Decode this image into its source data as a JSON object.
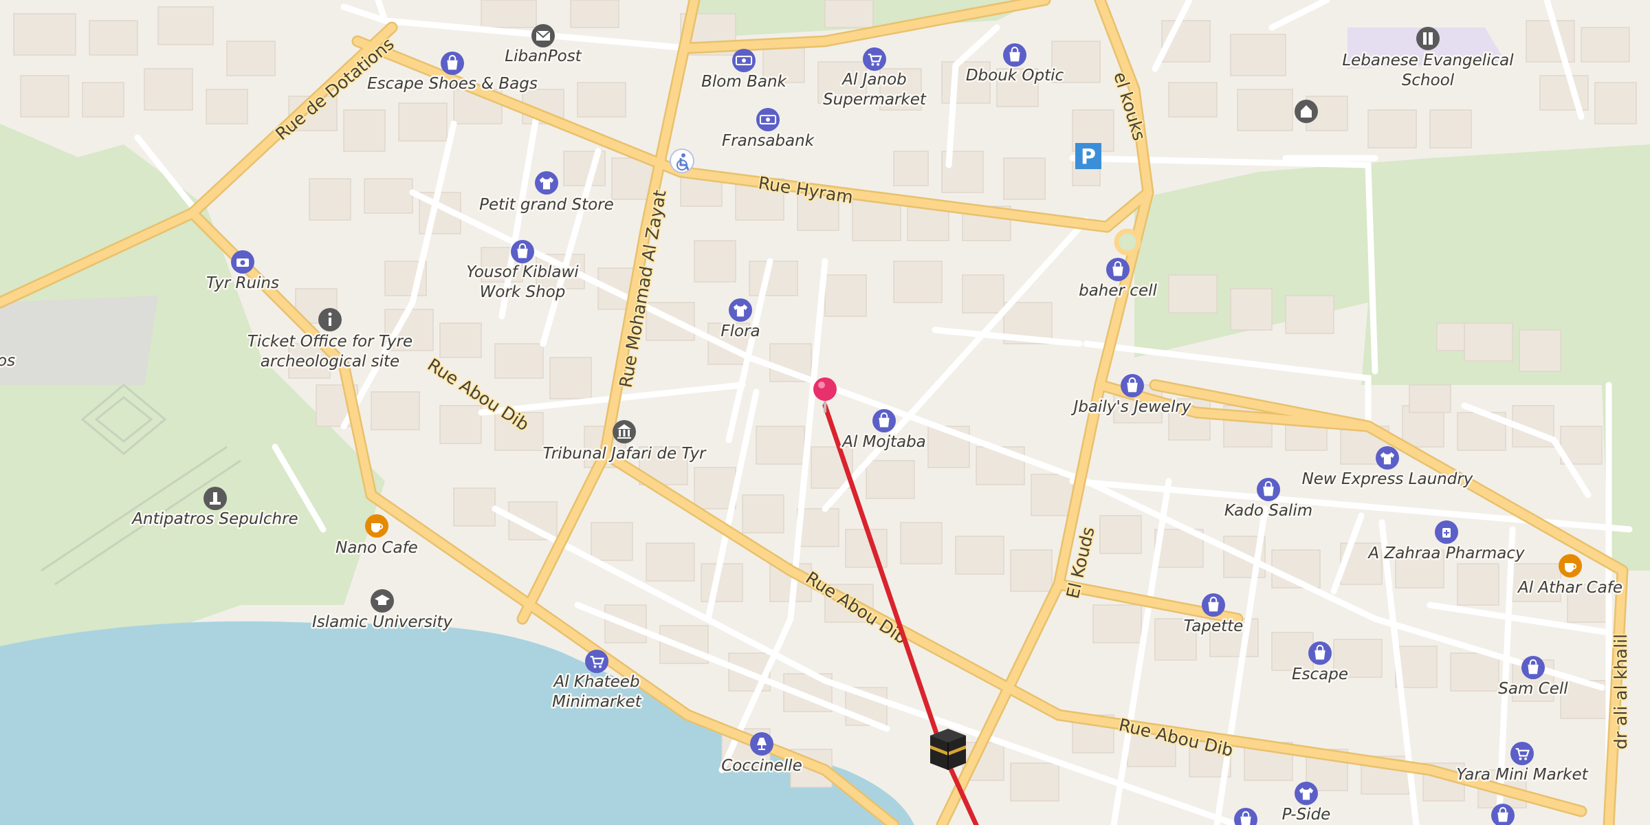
{
  "map": {
    "colors": {
      "land": "#f2efe9",
      "park": "#d8e8c8",
      "water": "#aad3df",
      "major_road": "#fcd68a",
      "minor_road": "#ffffff",
      "route": "#d9232d",
      "poi_icon": "#5b5fc7",
      "cafe_icon": "#e58a00",
      "pin": "#e8306b"
    },
    "pois": [
      {
        "id": "libanpost",
        "label": "LibanPost",
        "icon": "envelope-icon"
      },
      {
        "id": "escape-shoes",
        "label": "Escape Shoes & Bags",
        "icon": "shopping-bag-icon"
      },
      {
        "id": "blom-bank",
        "label": "Blom Bank",
        "icon": "banknote-icon"
      },
      {
        "id": "al-janob",
        "label": "Al Janob Supermarket",
        "icon": "shopping-cart-icon"
      },
      {
        "id": "dbouk-optic",
        "label": "Dbouk Optic",
        "icon": "shopping-bag-icon"
      },
      {
        "id": "fransabank",
        "label": "Fransabank",
        "icon": "banknote-icon"
      },
      {
        "id": "lebanese-evangelical",
        "label": "Lebanese Evangelical School",
        "icon": "school-icon"
      },
      {
        "id": "petit-grand-store",
        "label": "Petit grand Store",
        "icon": "shirt-icon"
      },
      {
        "id": "yousof-kiblawi",
        "label": "Yousof Kiblawi Work Shop",
        "icon": "shopping-bag-icon"
      },
      {
        "id": "flora",
        "label": "Flora",
        "icon": "shirt-icon"
      },
      {
        "id": "baher-cell",
        "label": "baher cell",
        "icon": "shopping-bag-icon"
      },
      {
        "id": "tyr-ruins",
        "label": "Tyr Ruins",
        "icon": "camera-icon"
      },
      {
        "id": "ticket-office",
        "label": "Ticket Office for Tyre archeological site",
        "icon": "info-icon"
      },
      {
        "id": "tribunal",
        "label": "Tribunal Jafari de Tyr",
        "icon": "courthouse-icon"
      },
      {
        "id": "al-mojtaba",
        "label": "Al Mojtaba",
        "icon": "shopping-bag-icon"
      },
      {
        "id": "jbailys-jewelry",
        "label": "Jbaily's Jewelry",
        "icon": "shopping-bag-icon"
      },
      {
        "id": "new-express-laundry",
        "label": "New Express Laundry",
        "icon": "shirt-icon"
      },
      {
        "id": "kado-salim",
        "label": "Kado Salim",
        "icon": "shopping-bag-icon"
      },
      {
        "id": "a-zahraa-pharmacy",
        "label": "A Zahraa Pharmacy",
        "icon": "pharmacy-icon"
      },
      {
        "id": "al-athar-cafe",
        "label": "Al Athar Cafe",
        "icon": "coffee-cup-icon"
      },
      {
        "id": "antipatros",
        "label": "Antipatros Sepulchre",
        "icon": "monument-icon"
      },
      {
        "id": "nano-cafe",
        "label": "Nano Cafe",
        "icon": "coffee-cup-icon"
      },
      {
        "id": "islamic-university",
        "label": "Islamic University",
        "icon": "graduation-cap-icon"
      },
      {
        "id": "tapette",
        "label": "Tapette",
        "icon": "shopping-bag-icon"
      },
      {
        "id": "escape",
        "label": "Escape",
        "icon": "shopping-bag-icon"
      },
      {
        "id": "sam-cell",
        "label": "Sam Cell",
        "icon": "shopping-bag-icon"
      },
      {
        "id": "al-khateeb",
        "label": "Al Khateeb Minimarket",
        "icon": "shopping-cart-icon"
      },
      {
        "id": "coccinelle",
        "label": "Coccinelle",
        "icon": "lamp-icon"
      },
      {
        "id": "yara-mini-market",
        "label": "Yara Mini Market",
        "icon": "shopping-cart-icon"
      },
      {
        "id": "p-side",
        "label": "P-Side",
        "icon": "shirt-icon"
      }
    ],
    "streets": {
      "rue_de_dotations": "Rue de Dotations",
      "rue_hyram": "Rue Hyram",
      "rue_mohamad_al_zayat": "Rue Mohamad Al Zayat",
      "el_kouks": "el kouks",
      "rue_abou_dib_1": "Rue Abou Dib",
      "rue_abou_dib_2": "Rue Abou Dib",
      "rue_abou_dib_3": "Rue Abou Dib",
      "el_kouds": "El Kouds",
      "dr_ali_al_khalil": "dr ali al khalil",
      "edge_label": "os"
    },
    "parking_label": "P"
  }
}
